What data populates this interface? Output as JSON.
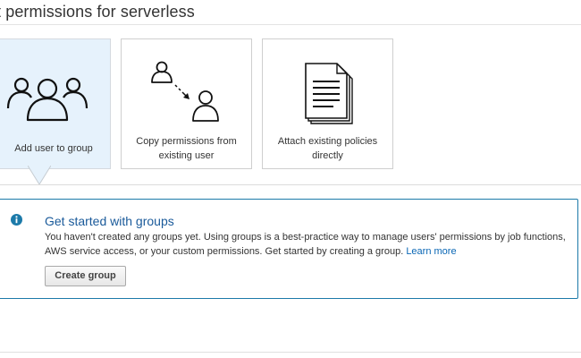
{
  "header": {
    "title": "t permissions for serverless"
  },
  "options": [
    {
      "id": "add-user-to-group",
      "label": "Add user to group",
      "selected": true,
      "icon": "users-group-icon"
    },
    {
      "id": "copy-permissions",
      "label_line1": "Copy permissions from",
      "label_line2": "existing user",
      "selected": false,
      "icon": "copy-user-icon"
    },
    {
      "id": "attach-policies",
      "label_line1": "Attach existing policies",
      "label_line2": "directly",
      "selected": false,
      "icon": "document-policy-icon"
    }
  ],
  "info": {
    "icon": "info-icon",
    "title": "Get started with groups",
    "text_line1": "You haven't created any groups yet. Using groups is a best-practice way to manage users' permissions by job functions,",
    "text_line2": "AWS service access, or your custom permissions. Get started by creating a group.",
    "link_text": "Learn more",
    "button_label": "Create group"
  },
  "colors": {
    "accent": "#1c7aa9",
    "title_blue": "#1a5a9a",
    "link": "#0a67b5",
    "selected_bg": "#e6f2fc"
  }
}
